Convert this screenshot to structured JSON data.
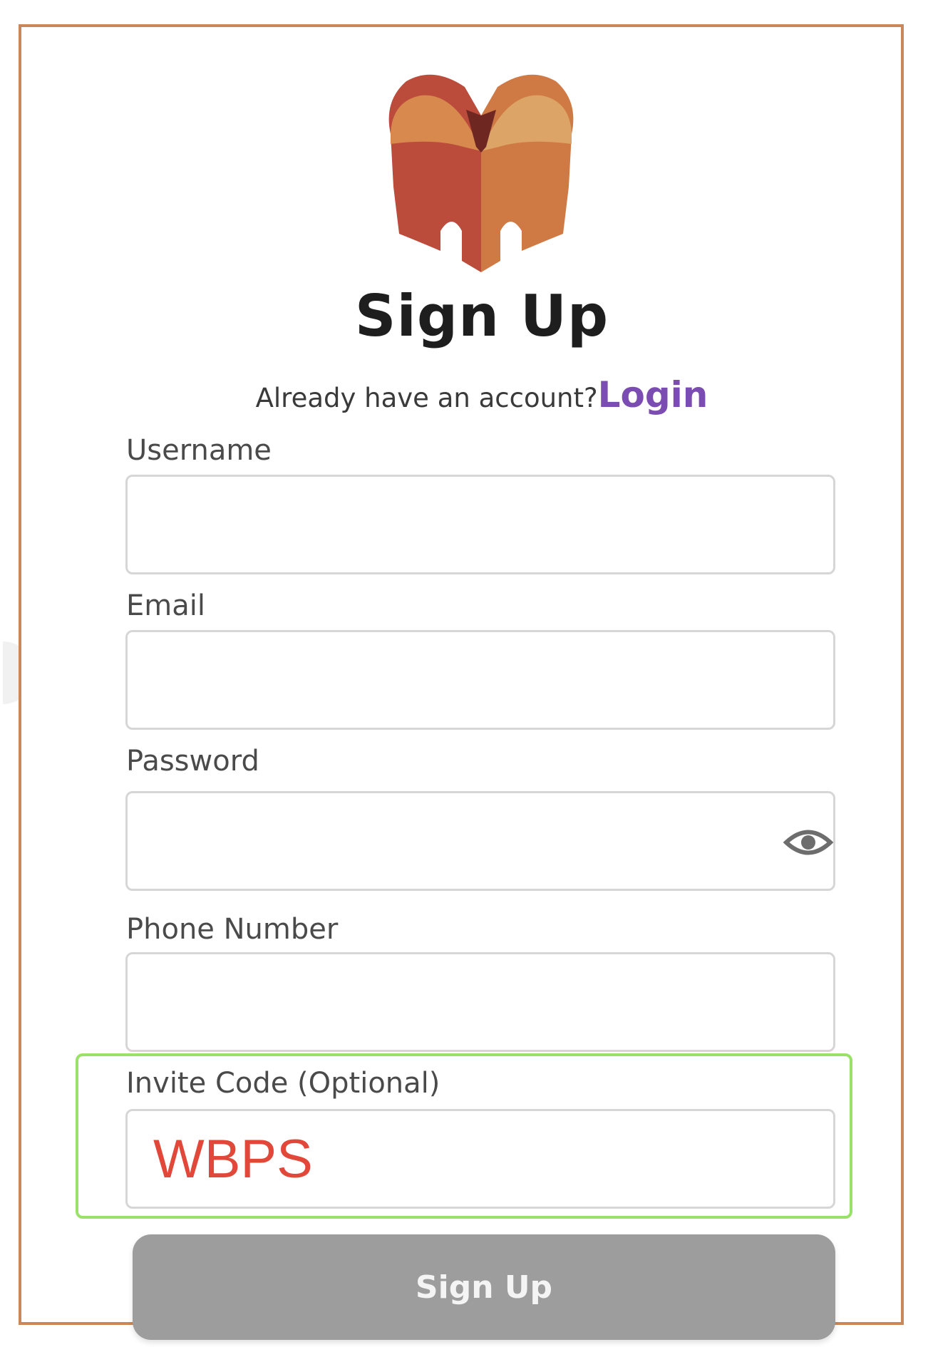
{
  "header": {
    "title": "Sign Up",
    "account_prompt": "Already have an account?",
    "login_link": "Login"
  },
  "form": {
    "username": {
      "label": "Username",
      "value": ""
    },
    "email": {
      "label": "Email",
      "value": ""
    },
    "password": {
      "label": "Password",
      "value": "",
      "toggle_icon": "eye-icon"
    },
    "phone": {
      "label": "Phone Number",
      "value": ""
    },
    "invite_code": {
      "label": "Invite Code (Optional)",
      "value": "WBPS"
    }
  },
  "submit": {
    "label": "Sign Up"
  },
  "colors": {
    "frame_border": "#c9875a",
    "link": "#7b4cb2",
    "invite_highlight": "#9ae16a",
    "invite_value_text": "#e2483a",
    "button_bg": "#9d9d9d"
  }
}
